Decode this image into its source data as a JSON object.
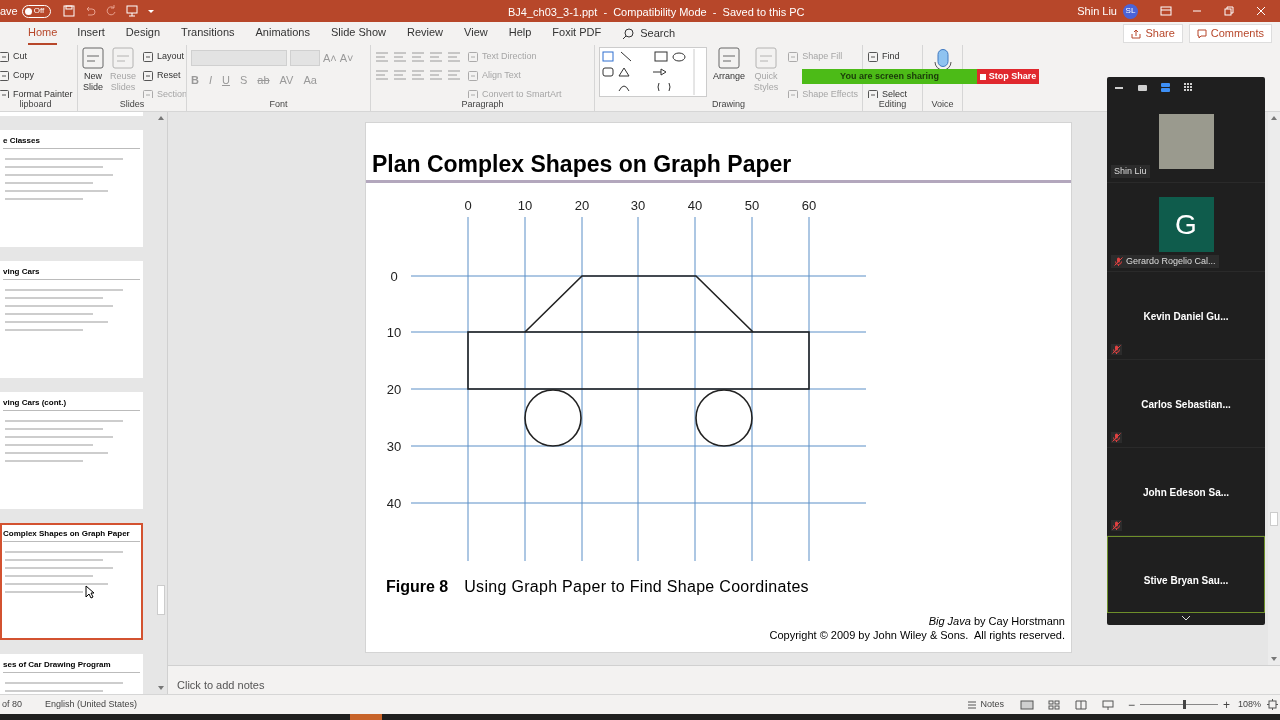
{
  "title_bar": {
    "autosave_label": "ave",
    "autosave_state": "Off",
    "autosave_on": false,
    "document_title": "BJ4_ch03_3-1.ppt  -  Compatibility Mode  -  Saved to this PC",
    "user_name": "Shin Liu",
    "user_initials": "SL"
  },
  "tabs": [
    {
      "label": "Home",
      "selected": true
    },
    {
      "label": "Insert",
      "selected": false
    },
    {
      "label": "Design",
      "selected": false
    },
    {
      "label": "Transitions",
      "selected": false
    },
    {
      "label": "Animations",
      "selected": false
    },
    {
      "label": "Slide Show",
      "selected": false
    },
    {
      "label": "Review",
      "selected": false
    },
    {
      "label": "View",
      "selected": false
    },
    {
      "label": "Help",
      "selected": false
    },
    {
      "label": "Foxit PDF",
      "selected": false
    }
  ],
  "search": {
    "placeholder": "Search"
  },
  "share_button": "Share",
  "comments_button": "Comments",
  "ribbon": {
    "clipboard": {
      "label": "lipboard",
      "items": [
        {
          "label": "Cut",
          "disabled": false
        },
        {
          "label": "Copy",
          "disabled": false
        },
        {
          "label": "Format Painter",
          "disabled": false
        }
      ]
    },
    "slides": {
      "label": "Slides",
      "large": [
        {
          "label": "New Slide",
          "disabled": false
        },
        {
          "label": "Reuse Slides",
          "disabled": true
        }
      ],
      "items": [
        {
          "label": "Layout",
          "disabled": false
        },
        {
          "label": "Reset",
          "disabled": false
        },
        {
          "label": "Section",
          "disabled": true
        }
      ]
    },
    "font": {
      "label": "Font",
      "buttons": [
        "B",
        "I",
        "U",
        "S",
        "ab",
        "AV",
        "Aa"
      ],
      "size_buttons": [
        "A˄",
        "A˅"
      ]
    },
    "paragraph": {
      "label": "Paragraph",
      "items": [
        {
          "label": "Text Direction",
          "disabled": true
        },
        {
          "label": "Align Text",
          "disabled": true
        },
        {
          "label": "Convert to SmartArt",
          "disabled": true
        }
      ]
    },
    "drawing": {
      "label": "Drawing",
      "large": [
        {
          "label": "Arrange",
          "disabled": false
        },
        {
          "label": "Quick Styles",
          "disabled": true
        }
      ],
      "items": [
        {
          "label": "Shape Fill",
          "disabled": true
        },
        {
          "label": "Shape Effects",
          "disabled": true
        }
      ]
    },
    "editing": {
      "label": "Editing",
      "items": [
        {
          "label": "Find",
          "disabled": false
        },
        {
          "label": "Select",
          "disabled": false
        }
      ]
    },
    "voice": {
      "label": "Voice"
    }
  },
  "sharing_banner": {
    "message": "You are screen sharing",
    "stop_button": "Stop Share"
  },
  "thumbnails": [
    {
      "title": "e Classes",
      "selected": false
    },
    {
      "title": "ving Cars",
      "selected": false
    },
    {
      "title": "ving Cars (cont.)",
      "selected": false
    },
    {
      "title": "Complex Shapes on Graph Paper",
      "selected": true
    },
    {
      "title": "ses of Car Drawing Program",
      "selected": false
    }
  ],
  "slide": {
    "title": "Plan Complex Shapes on Graph Paper",
    "x_labels": [
      "0",
      "10",
      "20",
      "30",
      "40",
      "50",
      "60"
    ],
    "y_labels": [
      "0",
      "10",
      "20",
      "30",
      "40"
    ],
    "figure_label": "Figure 8",
    "figure_caption": "Using Graph Paper to Find Shape Coordinates",
    "credit": "*Big Java* by Cay Horstmann",
    "copyright": "Copyright © 2009 by John Wiley & Sons.  All rights reserved."
  },
  "notes_placeholder": "Click to add notes",
  "meeting_panel": {
    "views": [
      {
        "selected": false
      },
      {
        "selected": false
      },
      {
        "selected": true
      },
      {
        "selected": false
      }
    ],
    "participants": [
      {
        "name": "Shin Liu",
        "kind": "video",
        "muted": false,
        "active": false
      },
      {
        "name": "Gerardo Rogelio Cal...",
        "kind": "avatar",
        "initial": "G",
        "muted": true,
        "active": false
      },
      {
        "name": "Kevin Daniel Gu...",
        "kind": "name",
        "muted": true,
        "active": false
      },
      {
        "name": "Carlos  Sebastian...",
        "kind": "name",
        "muted": true,
        "active": false
      },
      {
        "name": "John Edeson Sa...",
        "kind": "name",
        "muted": true,
        "active": false
      },
      {
        "name": "Stive Bryan Sau...",
        "kind": "name",
        "muted": false,
        "active": true
      }
    ]
  },
  "status_bar": {
    "slide_count": "of 80",
    "language": "English (United States)",
    "notes_button": "Notes",
    "zoom_out": "−",
    "zoom_slider": {
      "level": 0.55
    },
    "zoom_in": "+",
    "zoom_text": "108%"
  }
}
